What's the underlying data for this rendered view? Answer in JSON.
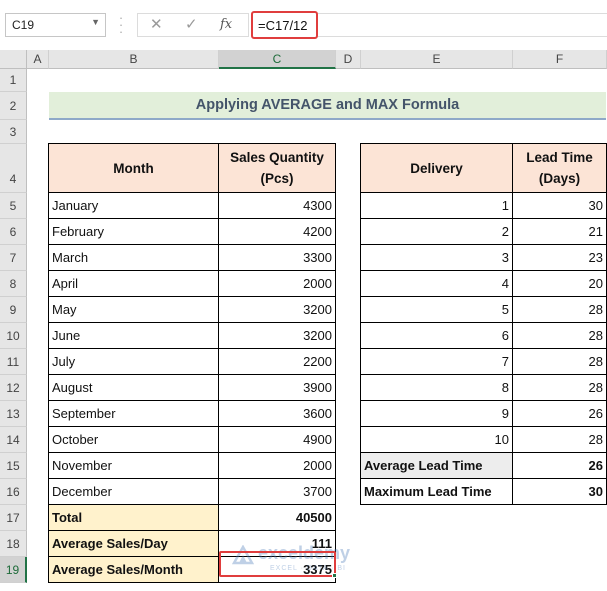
{
  "formula_bar": {
    "name_box": "C19",
    "formula": "=C17/12",
    "icons": [
      "cancel-icon",
      "enter-icon",
      "function-icon"
    ]
  },
  "columns": [
    "A",
    "B",
    "C",
    "D",
    "E",
    "F"
  ],
  "rows": [
    "1",
    "2",
    "3",
    "4",
    "5",
    "6",
    "7",
    "8",
    "9",
    "10",
    "11",
    "12",
    "13",
    "14",
    "15",
    "16",
    "17",
    "18",
    "19"
  ],
  "selected_cell": "C19",
  "title": "Applying AVERAGE and MAX Formula",
  "sales_table": {
    "headers": {
      "month": "Month",
      "qty": "Sales Quantity (Pcs)"
    },
    "rows": [
      [
        "January",
        "4300"
      ],
      [
        "February",
        "4200"
      ],
      [
        "March",
        "3300"
      ],
      [
        "April",
        "2000"
      ],
      [
        "May",
        "3200"
      ],
      [
        "June",
        "3200"
      ],
      [
        "July",
        "2200"
      ],
      [
        "August",
        "3900"
      ],
      [
        "September",
        "3600"
      ],
      [
        "October",
        "4900"
      ],
      [
        "November",
        "2000"
      ],
      [
        "December",
        "3700"
      ]
    ],
    "summary": [
      [
        "Total",
        "40500"
      ],
      [
        "Average Sales/Day",
        "111"
      ],
      [
        "Average Sales/Month",
        "3375"
      ]
    ]
  },
  "delivery_table": {
    "headers": {
      "delivery": "Delivery",
      "lead": "Lead Time (Days)"
    },
    "rows": [
      [
        "1",
        "30"
      ],
      [
        "2",
        "21"
      ],
      [
        "3",
        "23"
      ],
      [
        "4",
        "20"
      ],
      [
        "5",
        "28"
      ],
      [
        "6",
        "28"
      ],
      [
        "7",
        "28"
      ],
      [
        "8",
        "28"
      ],
      [
        "9",
        "26"
      ],
      [
        "10",
        "28"
      ]
    ],
    "summary": [
      [
        "Average Lead Time",
        "26"
      ],
      [
        "Maximum Lead Time",
        "30"
      ]
    ]
  },
  "watermark": {
    "name": "exceldemy",
    "tagline": "EXCEL · DATA · BI"
  },
  "colors": {
    "header_fill": "#fce4d6",
    "total_fill": "#fff2cc",
    "title_fill": "#e2efda",
    "highlight": "#e03d3d",
    "excel_green": "#217346"
  }
}
